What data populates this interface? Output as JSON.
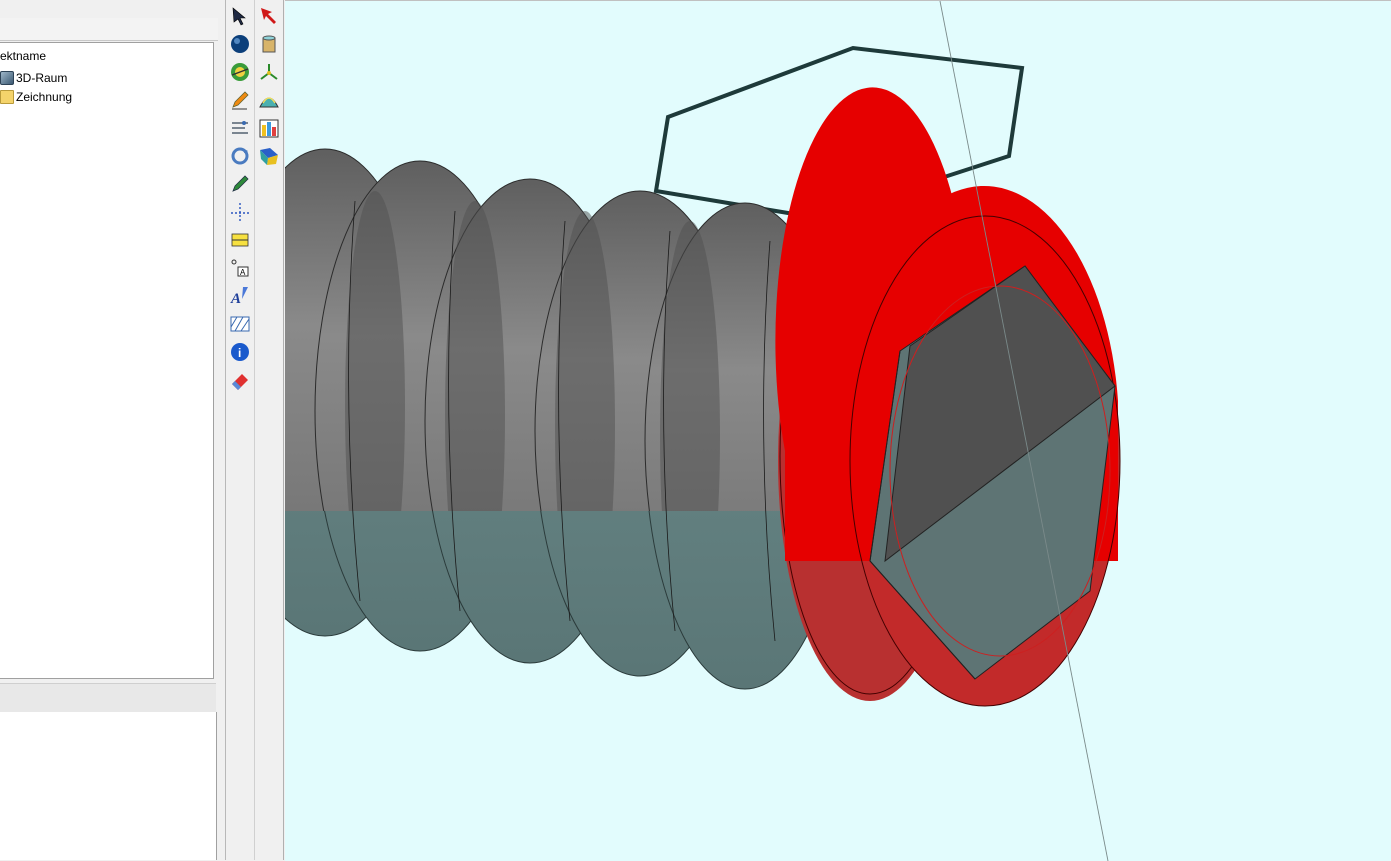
{
  "tree": {
    "header": "ektname",
    "items": [
      {
        "label": "3D-Raum",
        "icon": "3d-space-icon"
      },
      {
        "label": "Zeichnung",
        "icon": "drawing-icon"
      }
    ]
  },
  "toolbar_left": [
    {
      "icon": "select-pointer-icon"
    },
    {
      "icon": "sphere-icon"
    },
    {
      "icon": "globe-view-icon"
    },
    {
      "icon": "pencil-orange-icon"
    },
    {
      "icon": "transform-tools-icon"
    },
    {
      "icon": "rotate-icon"
    },
    {
      "icon": "pencil-green-icon"
    },
    {
      "icon": "dotted-axis-icon"
    },
    {
      "icon": "dimension-icon"
    },
    {
      "icon": "text-label-icon"
    },
    {
      "icon": "text-edit-icon"
    },
    {
      "icon": "hatch-icon"
    },
    {
      "icon": "info-icon"
    },
    {
      "icon": "eraser-icon"
    }
  ],
  "toolbar_right": [
    {
      "icon": "red-arrow-icon"
    },
    {
      "icon": "solid-cylinder-icon"
    },
    {
      "icon": "axes-icon"
    },
    {
      "icon": "surface-icon"
    },
    {
      "icon": "color-chart-icon"
    },
    {
      "icon": "render-book-icon"
    }
  ],
  "viewport": {
    "background": "#e2fcfd",
    "highlight_color": "#e60000",
    "thread_upper_color": "#7a7a7a",
    "thread_lower_color": "#5e7b7b"
  }
}
